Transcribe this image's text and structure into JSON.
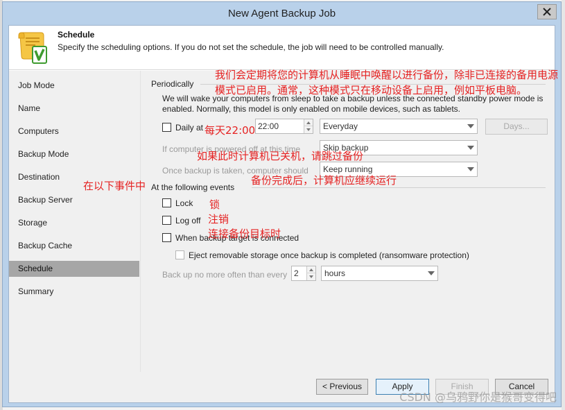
{
  "window": {
    "title": "New Agent Backup Job"
  },
  "header": {
    "title": "Schedule",
    "description": "Specify the scheduling options. If you do not set the schedule, the job will need to be controlled manually."
  },
  "sidebar": {
    "items": [
      {
        "label": "Job Mode"
      },
      {
        "label": "Name"
      },
      {
        "label": "Computers"
      },
      {
        "label": "Backup Mode"
      },
      {
        "label": "Destination"
      },
      {
        "label": "Backup Server"
      },
      {
        "label": "Storage"
      },
      {
        "label": "Backup Cache"
      },
      {
        "label": "Schedule",
        "active": true
      },
      {
        "label": "Summary"
      }
    ]
  },
  "periodically": {
    "label": "Periodically",
    "description": "We will wake your computers from sleep to take a backup unless the connected standby power mode is enabled. Normally, this model is only enabled on mobile devices, such as tablets.",
    "daily_at": {
      "label": "Daily at",
      "checked": false,
      "time": "22:00",
      "frequency": "Everyday",
      "days_button": "Days..."
    },
    "powered_off": {
      "label": "If computer is powered off at this time",
      "value": "Skip backup"
    },
    "after_backup": {
      "label": "Once backup is taken, computer should",
      "value": "Keep running"
    }
  },
  "events": {
    "label": "At the following events",
    "lock": {
      "label": "Lock",
      "checked": false
    },
    "logoff": {
      "label": "Log off",
      "checked": false
    },
    "target_connected": {
      "label": "When backup target is connected",
      "checked": false
    },
    "eject": {
      "label": "Eject removable storage once backup is completed (ransomware protection)",
      "checked": false
    },
    "no_more_often": {
      "label": "Back up no more often than every",
      "value": "2",
      "unit": "hours"
    }
  },
  "buttons": {
    "previous": "< Previous",
    "apply": "Apply",
    "finish": "Finish",
    "cancel": "Cancel"
  },
  "annotations": {
    "wake_note": "我们会定期将您的计算机从睡眠中唤醒以进行备份，除非已连接的备用电源模式已启用。通常，这种模式只在移动设备上启用，例如平板电脑。",
    "daily_note": "每天22:00",
    "poweroff_note": "如果此时计算机已关机，请跳过备份",
    "keep_running_note": "备份完成后，计算机应继续运行",
    "events_note": "在以下事件中",
    "lock_note": "锁",
    "logoff_note": "注销",
    "connected_note": "连接备份目标时"
  },
  "watermark": "CSDN @乌鸦野你是猴哥变得吧",
  "colors": {
    "annotation": "#e52222",
    "titlebar": "#b9d1ea",
    "active_nav": "#a6a6a6"
  }
}
